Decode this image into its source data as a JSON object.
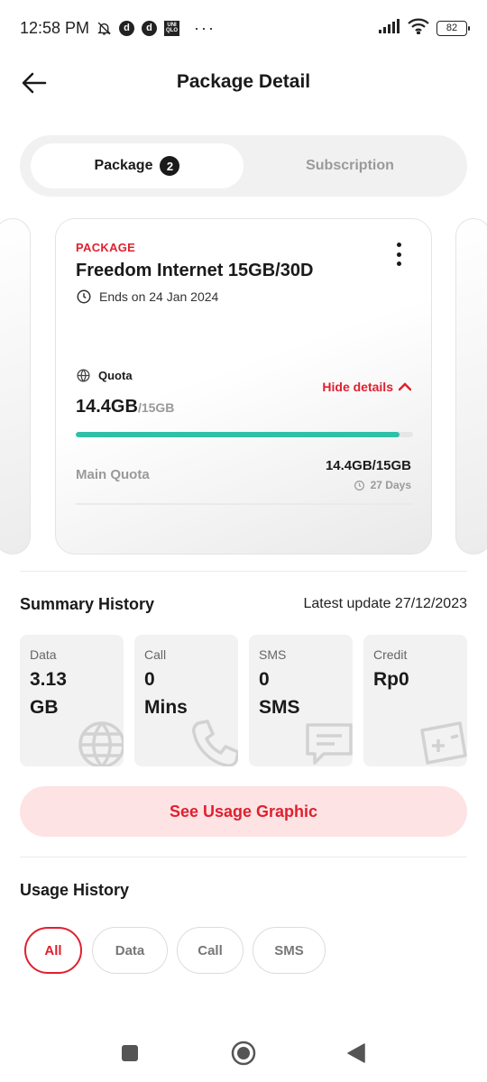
{
  "status_bar": {
    "time": "12:58 PM",
    "notif_d1": "d",
    "notif_d2": "d",
    "notif_uq_top": "UNI",
    "notif_uq_bottom": "QLO",
    "more": "···",
    "battery": "82"
  },
  "header": {
    "title": "Package Detail",
    "back_icon": "arrow-left-icon"
  },
  "tabs": [
    {
      "label": "Package",
      "badge": "2",
      "active": true
    },
    {
      "label": "Subscription",
      "active": false
    }
  ],
  "package_card": {
    "label": "PACKAGE",
    "name": "Freedom Internet 15GB/30D",
    "ends": "Ends on 24 Jan 2024",
    "quota_label": "Quota",
    "hide_details": "Hide details",
    "quota_used": "14.4GB",
    "quota_total": "/15GB",
    "quota_fraction": 0.96,
    "main_quota_label": "Main Quota",
    "main_quota_value": "14.4GB/15GB",
    "days_left": "27 Days",
    "accent_color": "#e0202f",
    "progress_color": "#2fc0a8"
  },
  "summary": {
    "title": "Summary History",
    "latest_update": "Latest update 27/12/2023",
    "items": [
      {
        "label": "Data",
        "value_line1": "3.13",
        "value_line2": "GB",
        "icon": "globe-icon"
      },
      {
        "label": "Call",
        "value_line1": "0",
        "value_line2": "Mins",
        "icon": "phone-icon"
      },
      {
        "label": "SMS",
        "value_line1": "0",
        "value_line2": "SMS",
        "icon": "chat-icon"
      },
      {
        "label": "Credit",
        "value_line1": "Rp0",
        "value_line2": "",
        "icon": "credit-card-icon"
      }
    ]
  },
  "usage_graphic_button": "See Usage Graphic",
  "usage_history": {
    "title": "Usage History",
    "filters": [
      {
        "label": "All",
        "active": true
      },
      {
        "label": "Data",
        "active": false
      },
      {
        "label": "Call",
        "active": false
      },
      {
        "label": "SMS",
        "active": false
      }
    ]
  }
}
